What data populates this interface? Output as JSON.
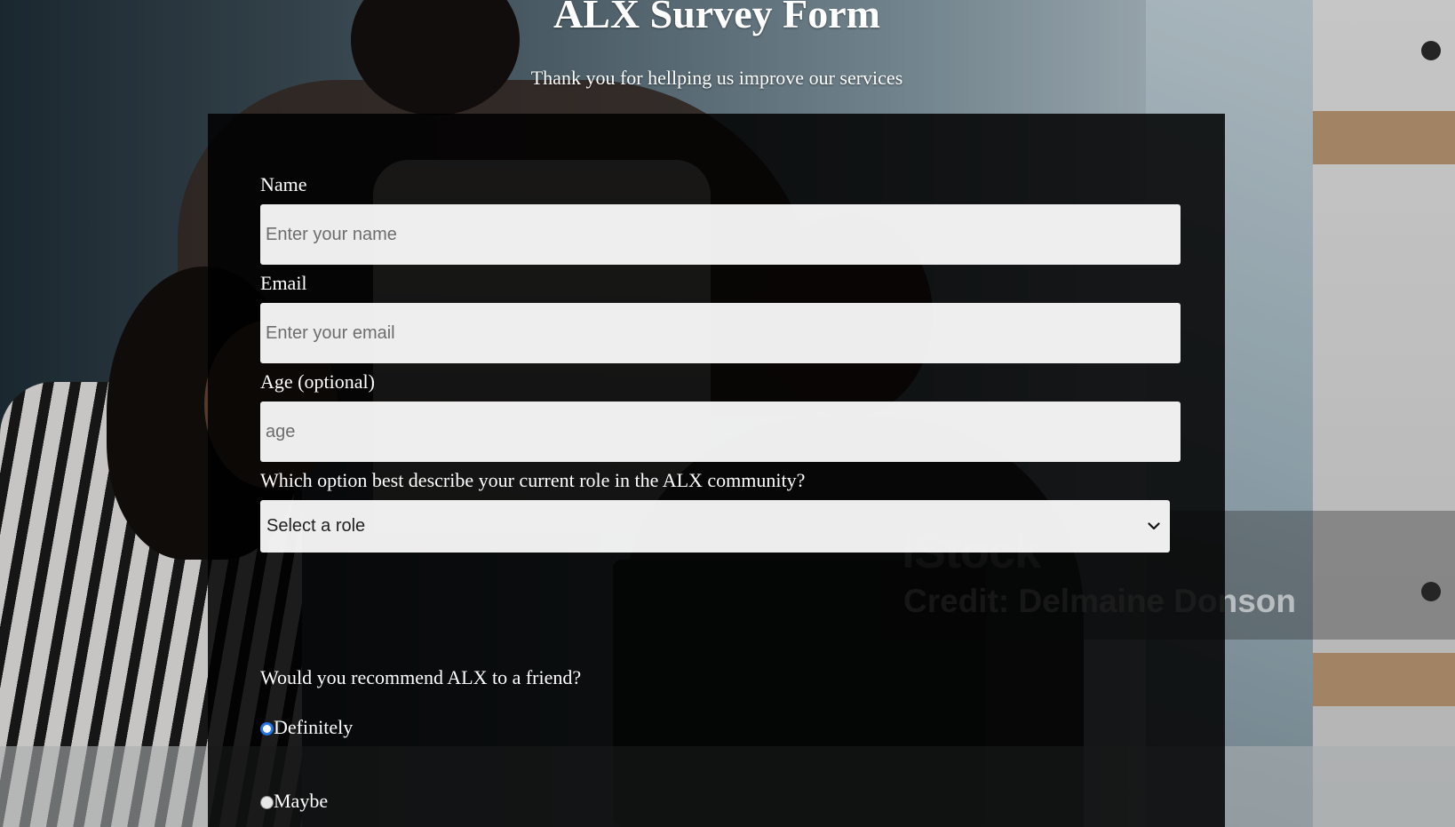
{
  "header": {
    "title": "ALX Survey Form",
    "subtitle": "Thank you for hellping us improve our services"
  },
  "watermark": {
    "logo": "iStock",
    "credit": "Credit: Delmaine Donson"
  },
  "form": {
    "name": {
      "label": "Name",
      "placeholder": "Enter your name",
      "value": ""
    },
    "email": {
      "label": "Email",
      "placeholder": "Enter your email",
      "value": ""
    },
    "age": {
      "label": "Age (optional)",
      "placeholder": "age",
      "value": ""
    },
    "role": {
      "label": "Which option best describe your current role in the ALX community?",
      "selected": "Select a role",
      "icon": "chevron-down-icon"
    },
    "recommend": {
      "label": "Would you recommend ALX to a friend?",
      "options": [
        {
          "label": "Definitely",
          "selected": true
        },
        {
          "label": "Maybe",
          "selected": false
        }
      ]
    }
  },
  "colors": {
    "panel": "#000000",
    "radio_accent": "#1f6fe5",
    "text": "#ffffff"
  }
}
